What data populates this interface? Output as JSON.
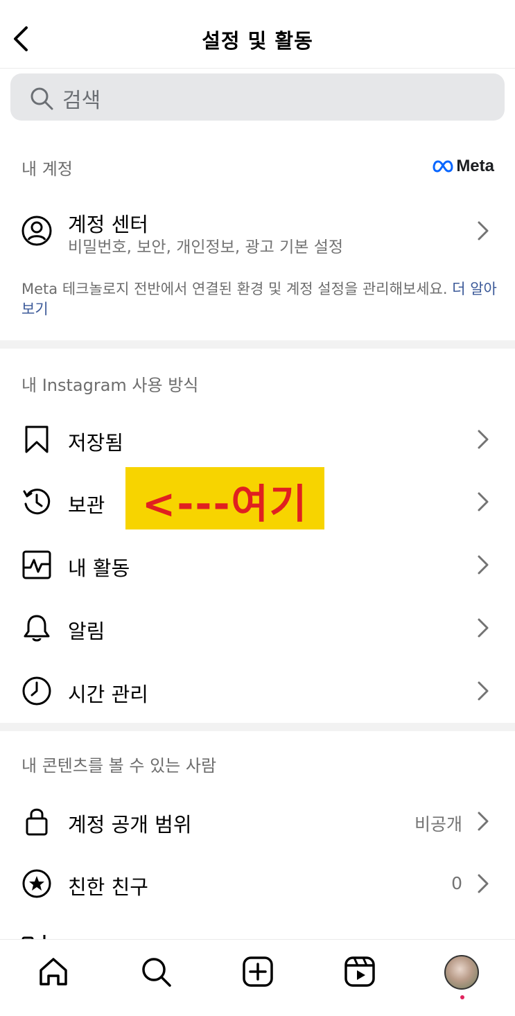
{
  "header": {
    "title": "설정 및 활동"
  },
  "search": {
    "placeholder": "검색"
  },
  "account_section": {
    "heading": "내 계정",
    "meta_label": "Meta",
    "center": {
      "title": "계정 센터",
      "subtitle": "비밀번호, 보안, 개인정보, 광고 기본 설정"
    },
    "description": "Meta 테크놀로지 전반에서 연결된 환경 및 계정 설정을 관리해보세요.",
    "learn_more": "더 알아보기"
  },
  "usage_section": {
    "heading": "내 Instagram 사용 방식",
    "items": [
      {
        "label": "저장됨",
        "icon": "bookmark-icon"
      },
      {
        "label": "보관",
        "icon": "archive-history-icon"
      },
      {
        "label": "내 활동",
        "icon": "activity-icon"
      },
      {
        "label": "알림",
        "icon": "bell-icon"
      },
      {
        "label": "시간 관리",
        "icon": "clock-icon"
      }
    ]
  },
  "annotation": {
    "text": "<---여기",
    "background": "#f7d400",
    "color": "#e02020"
  },
  "content_section": {
    "heading": "내 콘텐츠를 볼 수 있는 사람",
    "items": [
      {
        "label": "계정 공개 범위",
        "value": "비공개",
        "icon": "lock-icon"
      },
      {
        "label": "친한 친구",
        "value": "0",
        "icon": "star-circle-icon"
      }
    ]
  },
  "bottom_nav": {
    "items": [
      "home-icon",
      "search-icon",
      "create-icon",
      "reels-icon",
      "profile-avatar"
    ]
  }
}
